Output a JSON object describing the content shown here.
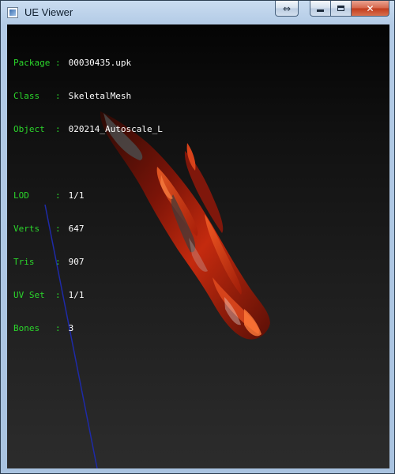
{
  "window": {
    "title": "UE Viewer",
    "buttons": {
      "extra": "⇔",
      "minimize": "",
      "maximize": "",
      "close": "✕"
    }
  },
  "info": {
    "package_label": "Package :",
    "package_value": "00030435.upk",
    "class_label": "Class   :",
    "class_value": "SkeletalMesh",
    "object_label": "Object  :",
    "object_value": "020214_Autoscale_L",
    "lod_label": "LOD     :",
    "lod_value": "1/1",
    "verts_label": "Verts   :",
    "verts_value": "647",
    "tris_label": "Tris    :",
    "tris_value": "907",
    "uvset_label": "UV Set  :",
    "uvset_value": "1/1",
    "bones_label": "Bones   :",
    "bones_value": "3"
  },
  "colors": {
    "label": "#2bd62b",
    "value": "#ffffff",
    "axis": "#1e2aa8",
    "mesh_dark": "#3a0d06",
    "mesh_red": "#b21e0a",
    "mesh_orange": "#ff5a1e"
  }
}
